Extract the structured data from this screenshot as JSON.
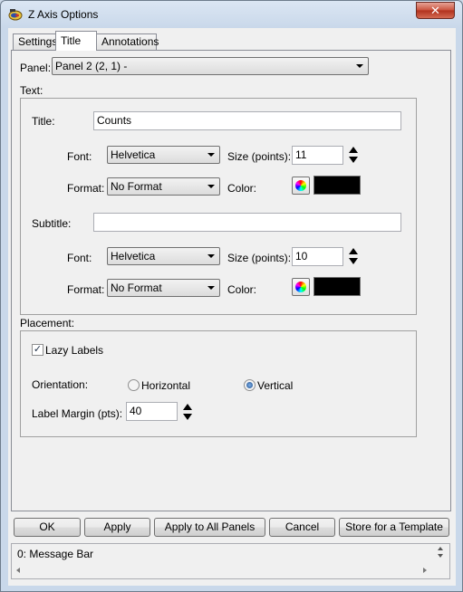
{
  "window": {
    "title": "Z Axis Options",
    "close_glyph": "✕"
  },
  "tabs": [
    {
      "label": "Settings"
    },
    {
      "label": "Title"
    },
    {
      "label": "Annotations"
    }
  ],
  "panel": {
    "label": "Panel:",
    "value": "Panel 2 (2, 1)  -"
  },
  "text_section": {
    "label": "Text:",
    "title_row": {
      "label": "Title:",
      "value": "Counts",
      "font_label": "Font:",
      "font_value": "Helvetica",
      "size_label": "Size (points):",
      "size_value": "11",
      "format_label": "Format:",
      "format_value": "No Format",
      "color_label": "Color:",
      "color": "#000000"
    },
    "subtitle_row": {
      "label": "Subtitle:",
      "value": "",
      "font_label": "Font:",
      "font_value": "Helvetica",
      "size_label": "Size (points):",
      "size_value": "10",
      "format_label": "Format:",
      "format_value": "No Format",
      "color_label": "Color:",
      "color": "#000000"
    }
  },
  "placement_section": {
    "label": "Placement:",
    "lazy_labels": {
      "label": "Lazy Labels",
      "checked": true,
      "check_glyph": "✓"
    },
    "orientation": {
      "label": "Orientation:",
      "options": [
        "Horizontal",
        "Vertical"
      ],
      "selected": "Vertical"
    },
    "label_margin": {
      "label": "Label Margin (pts):",
      "value": "40"
    }
  },
  "buttons": {
    "ok": "OK",
    "apply": "Apply",
    "apply_all": "Apply to All Panels",
    "cancel": "Cancel",
    "store_template": "Store for a Template"
  },
  "message_bar": {
    "text": "0: Message Bar"
  }
}
